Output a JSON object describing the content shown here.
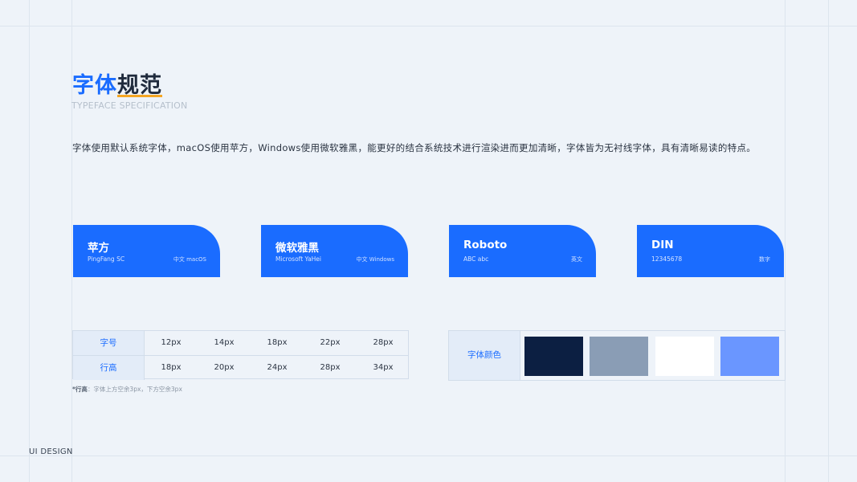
{
  "header": {
    "title_part1": "字体",
    "title_part2": "规范",
    "subtitle": "TYPEFACE SPECIFICATION",
    "description": "字体使用默认系统字体，macOS使用苹方，Windows使用微软雅黑，能更好的结合系统技术进行渲染进而更加清晰，字体皆为无衬线字体，具有清晰易读的特点。"
  },
  "fonts": [
    {
      "name": "苹方",
      "english": "PingFang SC",
      "note": "中文 macOS"
    },
    {
      "name": "微软雅黑",
      "english": "Microsoft YaHei",
      "note": "中文 Windows"
    },
    {
      "name": "Roboto",
      "english": "ABC abc",
      "note": "英文"
    },
    {
      "name": "DIN",
      "english": "12345678",
      "note": "数字"
    }
  ],
  "size_table": {
    "rows": [
      {
        "label": "字号",
        "values": [
          "12px",
          "14px",
          "18px",
          "22px",
          "28px"
        ]
      },
      {
        "label": "行高",
        "values": [
          "18px",
          "20px",
          "24px",
          "28px",
          "34px"
        ]
      }
    ]
  },
  "footnote": {
    "label": "*行高",
    "text": "：字体上方空余3px，下方空余3px"
  },
  "colors": {
    "label": "字体颜色",
    "swatches": [
      "#0c1f42",
      "#8a9db5",
      "#ffffff",
      "#6a96ff"
    ]
  },
  "accent_color": "#1a6cff",
  "footer": "UI DESIGN"
}
